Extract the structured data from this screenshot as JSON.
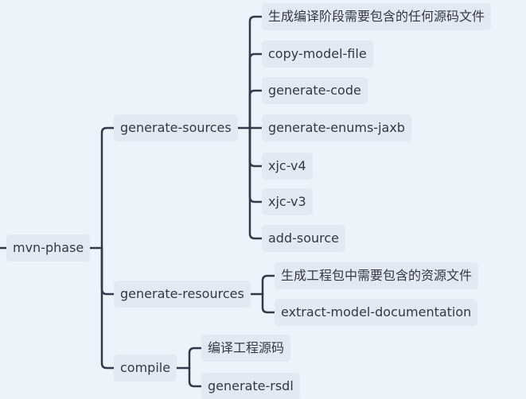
{
  "mindmap": {
    "root": {
      "label": "mvn-phase"
    },
    "branches": [
      {
        "label": "generate-sources",
        "children": [
          "生成编译阶段需要包含的任何源码文件",
          "copy-model-file",
          "generate-code",
          "generate-enums-jaxb",
          "xjc-v4",
          "xjc-v3",
          "add-source"
        ]
      },
      {
        "label": "generate-resources",
        "children": [
          "生成工程包中需要包含的资源文件",
          "extract-model-documentation"
        ]
      },
      {
        "label": "compile",
        "children": [
          "编译工程源码",
          "generate-rsdl"
        ]
      }
    ]
  },
  "colors": {
    "background": "#edf3fb",
    "node_fill": "#e2e9f2",
    "text": "#333844",
    "line": "#2f3a4a"
  }
}
